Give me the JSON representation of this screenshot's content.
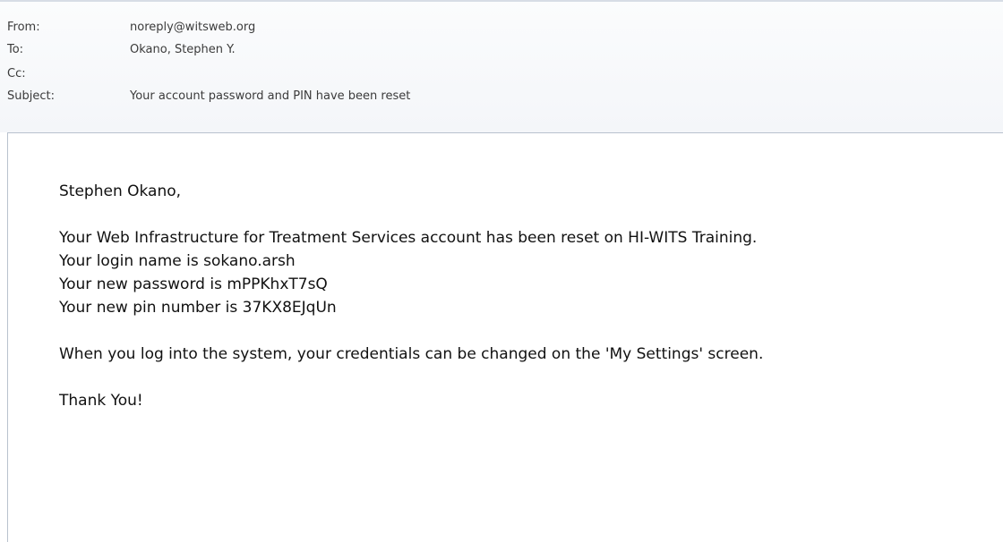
{
  "header": {
    "from_label": "From:",
    "from_value": "noreply@witsweb.org",
    "to_label": "To:",
    "to_value": "Okano, Stephen Y.",
    "cc_label": "Cc:",
    "cc_value": "",
    "subject_label": "Subject:",
    "subject_value": "Your account password and PIN have been reset"
  },
  "body": {
    "greeting": "Stephen Okano,",
    "line1": "Your Web Infrastructure for Treatment Services account has been reset on HI-WITS Training.",
    "line2": "Your login name is sokano.arsh",
    "line3": "Your new password is mPPKhxT7sQ",
    "line4": "Your new pin number is 37KX8EJqUn",
    "line5": "When you log into the system, your credentials can be changed on the 'My Settings' screen.",
    "closing": "Thank You!"
  }
}
